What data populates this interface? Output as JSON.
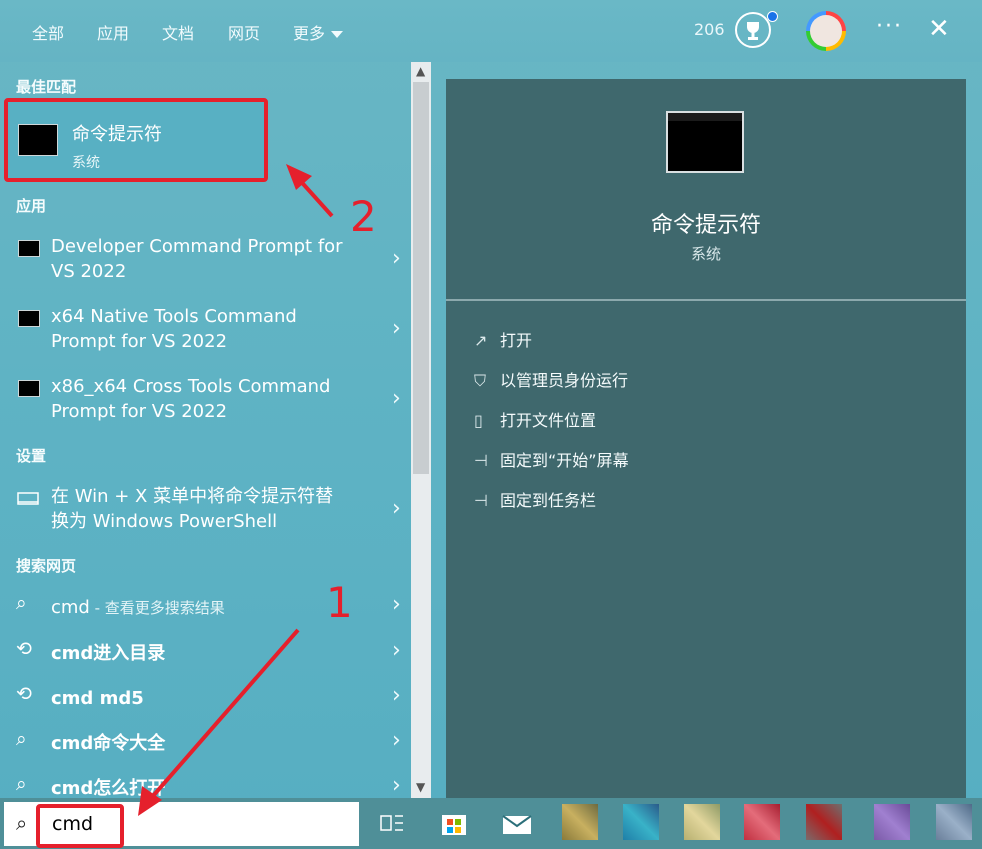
{
  "top_tabs": [
    "全部",
    "应用",
    "文档",
    "网页",
    "更多"
  ],
  "points": "206",
  "more_glyph": "···",
  "close_glyph": "✕",
  "sections": {
    "best": "最佳匹配",
    "apps": "应用",
    "settings": "设置",
    "web": "搜索网页"
  },
  "best_match": {
    "title": "命令提示符",
    "subtitle": "系统"
  },
  "apps": [
    {
      "line1": "Developer Command Prompt for",
      "line2": "VS 2022"
    },
    {
      "line1": "x64 Native Tools Command",
      "line2": "Prompt for VS 2022"
    },
    {
      "line1": "x86_x64 Cross Tools Command",
      "line2": "Prompt for VS 2022"
    }
  ],
  "setting": {
    "line1": "在 Win + X 菜单中将命令提示符替",
    "line2": "换为 Windows PowerShell"
  },
  "web": [
    {
      "text": "cmd",
      "sub": " - 查看更多搜索结果",
      "icon": "search-icon"
    },
    {
      "text": "cmd进入目录",
      "icon": "history-icon"
    },
    {
      "text": "cmd md5",
      "icon": "history-icon"
    },
    {
      "text": "cmd命令大全",
      "icon": "search-icon"
    },
    {
      "text": "cmd怎么打开",
      "icon": "search-icon"
    }
  ],
  "detail": {
    "title": "命令提示符",
    "subtitle": "系统"
  },
  "actions": [
    {
      "label": "打开",
      "icon": "open-icon"
    },
    {
      "label": "以管理员身份运行",
      "icon": "admin-shield-icon"
    },
    {
      "label": "打开文件位置",
      "icon": "file-location-icon"
    },
    {
      "label": "固定到“开始”屏幕",
      "icon": "pin-icon"
    },
    {
      "label": "固定到任务栏",
      "icon": "pin-icon"
    }
  ],
  "search": {
    "value": "cmd"
  },
  "annotations": {
    "label1": "1",
    "label2": "2",
    "color": "#e5202c"
  }
}
